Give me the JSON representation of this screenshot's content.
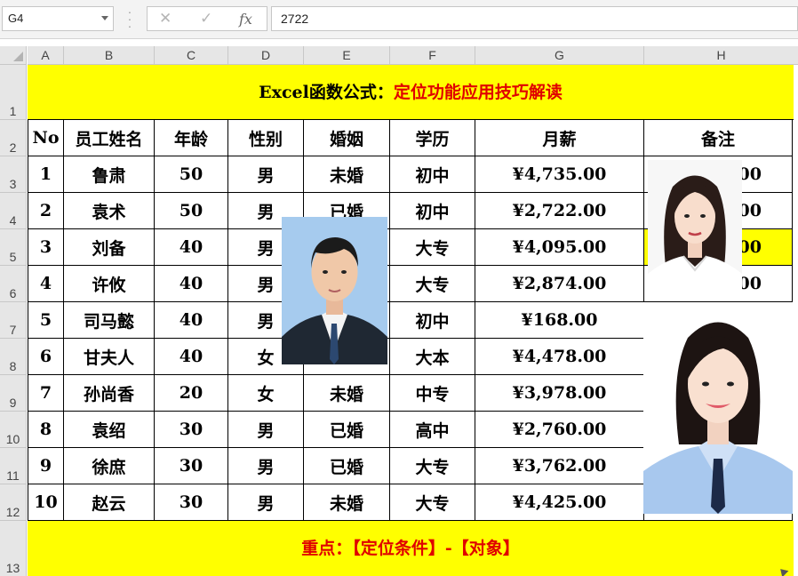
{
  "formula_bar": {
    "name_box": "G4",
    "formula": "2722",
    "fx_label": "fx"
  },
  "columns": [
    "A",
    "B",
    "C",
    "D",
    "E",
    "F",
    "G",
    "H"
  ],
  "rows": [
    "1",
    "2",
    "3",
    "4",
    "5",
    "6",
    "7",
    "8",
    "9",
    "10",
    "11",
    "12",
    "13"
  ],
  "title": {
    "part1": "Excel函数公式：",
    "part2": "定位功能应用技巧解读"
  },
  "table": {
    "headers": [
      "No",
      "员工姓名",
      "年龄",
      "性别",
      "婚姻",
      "学历",
      "月薪",
      "备注"
    ],
    "rows": [
      [
        "1",
        "鲁肃",
        "50",
        "男",
        "未婚",
        "初中",
        "¥4,735.00",
        "00"
      ],
      [
        "2",
        "袁术",
        "50",
        "男",
        "已婚",
        "初中",
        "¥2,722.00",
        "00"
      ],
      [
        "3",
        "刘备",
        "40",
        "男",
        "",
        "大专",
        "¥4,095.00",
        "00"
      ],
      [
        "4",
        "许攸",
        "40",
        "男",
        "",
        "大专",
        "¥2,874.00",
        "00"
      ],
      [
        "5",
        "司马懿",
        "40",
        "男",
        "",
        "初中",
        "¥168.00",
        ""
      ],
      [
        "6",
        "甘夫人",
        "40",
        "女",
        "",
        "大本",
        "¥4,478.00",
        ""
      ],
      [
        "7",
        "孙尚香",
        "20",
        "女",
        "未婚",
        "中专",
        "¥3,978.00",
        ""
      ],
      [
        "8",
        "袁绍",
        "30",
        "男",
        "已婚",
        "高中",
        "¥2,760.00",
        ""
      ],
      [
        "9",
        "徐庶",
        "30",
        "男",
        "已婚",
        "大专",
        "¥3,762.00",
        ""
      ],
      [
        "10",
        "赵云",
        "30",
        "男",
        "未婚",
        "大专",
        "¥4,425.00",
        ""
      ]
    ]
  },
  "footer": {
    "part1": "重点：",
    "part2": "【定位条件】-【对象】"
  },
  "colors": {
    "banner": "#ffff00",
    "accent_red": "#e00000",
    "header_bg": "#e6e6e6"
  }
}
